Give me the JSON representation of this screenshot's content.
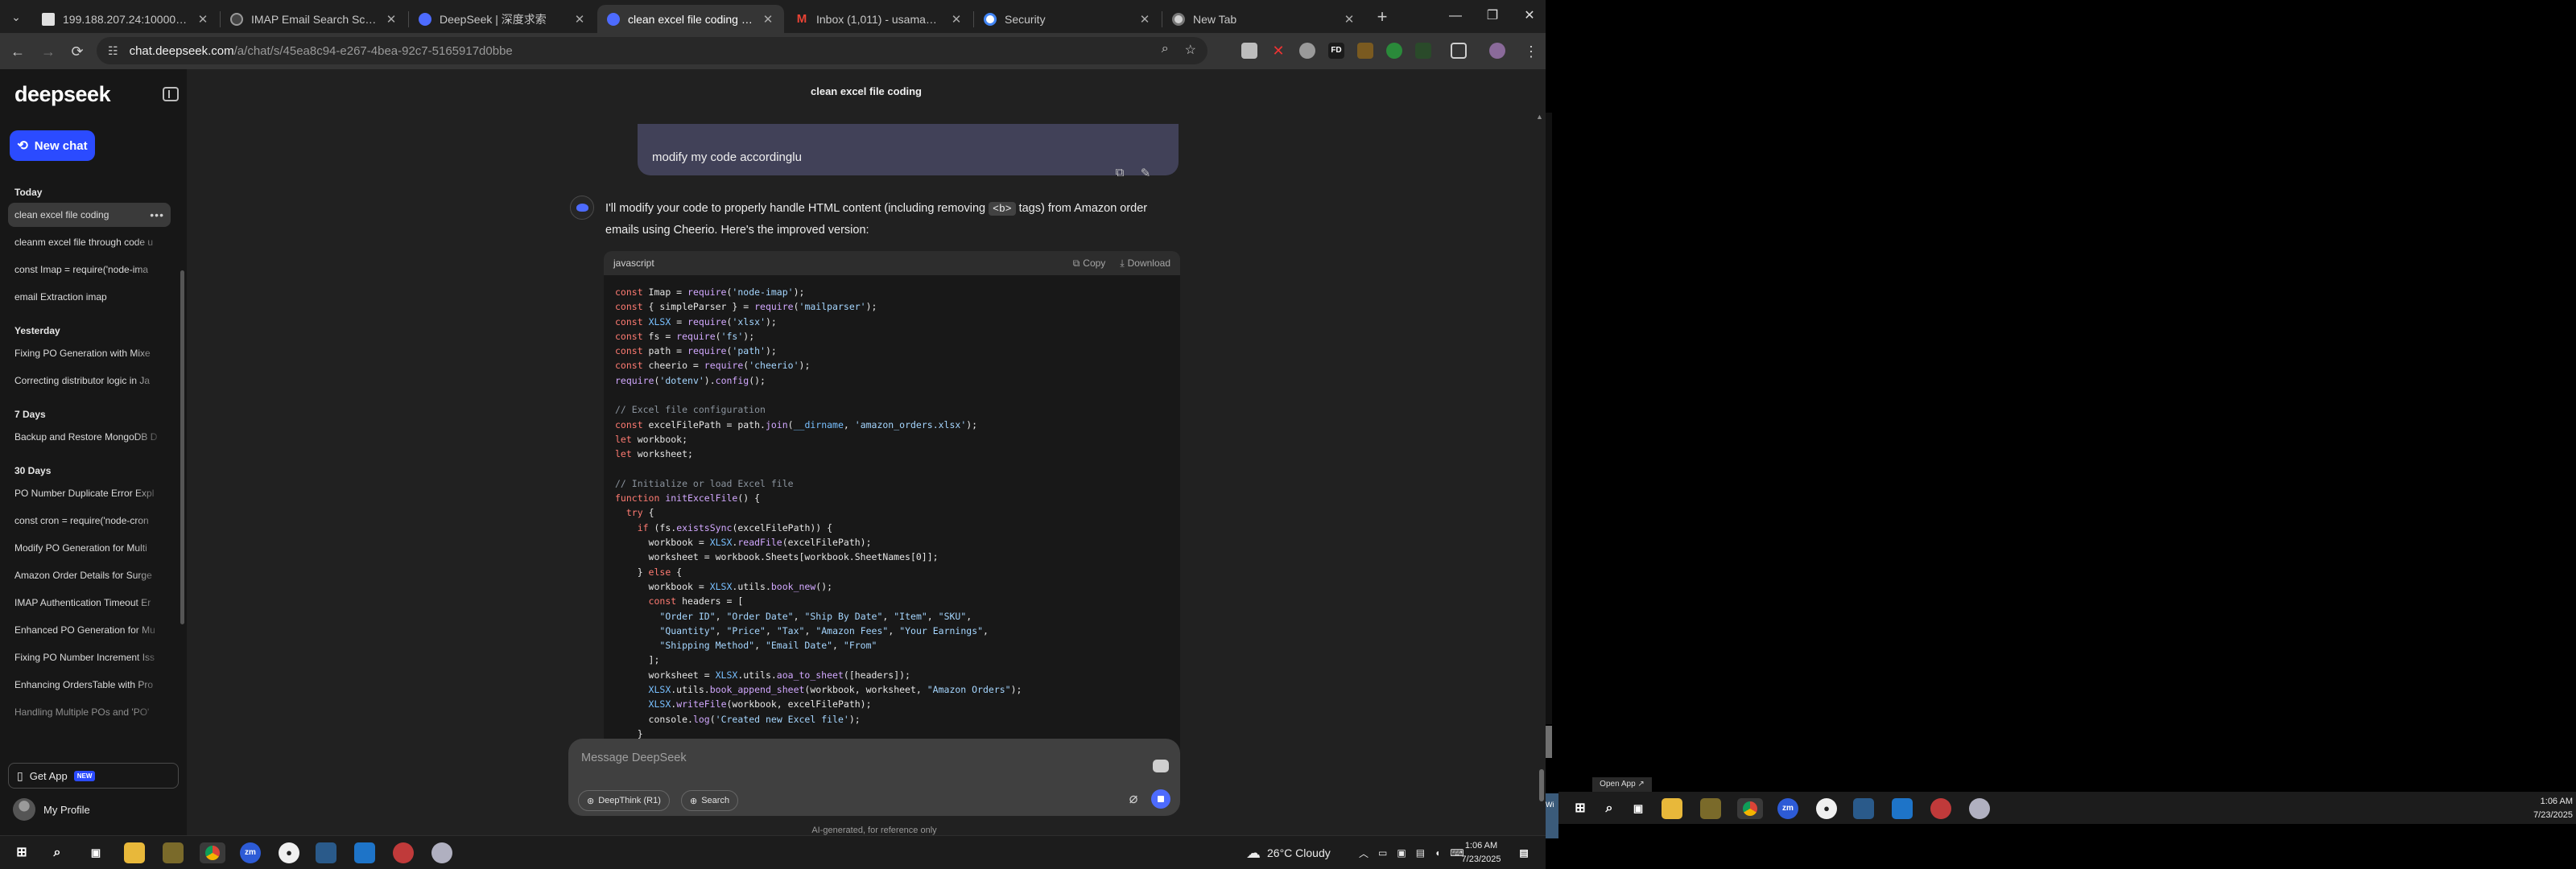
{
  "browser": {
    "tabs": [
      {
        "title": "199.188.207.24:10000/dashbo",
        "favicon": "warning-icon",
        "favicon_color": "#e0e0e0"
      },
      {
        "title": "IMAP Email Search Script",
        "favicon": "openai-icon",
        "favicon_color": "#444444"
      },
      {
        "title": "DeepSeek | 深度求索",
        "favicon": "deepseek-icon",
        "favicon_color": "#4d6bfe"
      },
      {
        "title": "clean excel file coding - Deeps",
        "favicon": "deepseek-icon",
        "favicon_color": "#4d6bfe"
      },
      {
        "title": "Inbox (1,011) - usamabin2580",
        "favicon": "gmail-icon",
        "favicon_color": "#ea4335"
      },
      {
        "title": "Security",
        "favicon": "google-icon",
        "favicon_color": "#ffffff"
      },
      {
        "title": "New Tab",
        "favicon": "chrome-icon",
        "favicon_color": "#d0d0d0"
      }
    ],
    "active_tab": 3,
    "url_host": "chat.deepseek.com",
    "url_path": "/a/chat/s/45ea8c94-e267-4bea-92c7-5165917d0bbe"
  },
  "sidebar": {
    "logo": "deepseek",
    "new_chat": "New chat",
    "groups": [
      {
        "label": "Today",
        "items": [
          "clean excel file coding",
          "cleanm excel file through code u",
          "const Imap = require('node-ima",
          "email Extraction imap"
        ]
      },
      {
        "label": "Yesterday",
        "items": [
          "Fixing PO Generation with Mixe",
          "Correcting distributor logic in Ja"
        ]
      },
      {
        "label": "7 Days",
        "items": [
          "Backup and Restore MongoDB D"
        ]
      },
      {
        "label": "30 Days",
        "items": [
          "PO Number Duplicate Error Expl",
          "const cron = require('node-cron",
          "Modify PO Generation for Multi",
          "Amazon Order Details for Surge",
          "IMAP Authentication Timeout Er",
          "Enhanced PO Generation for Mu",
          "Fixing PO Number Increment Iss",
          "Enhancing OrdersTable with Pro",
          "Handling Multiple POs and 'PO'"
        ]
      }
    ],
    "get_app": "Get App",
    "get_app_badge": "NEW",
    "profile": "My Profile"
  },
  "chat": {
    "title": "clean excel file coding",
    "user_message": "modify my code accordinglu",
    "answer_before": "I'll modify your code to properly handle HTML content (including removing ",
    "answer_code": "<b>",
    "answer_after": " tags) from Amazon order emails using Cheerio. Here's the improved version:",
    "code_lang": "javascript",
    "copy_label": "Copy",
    "download_label": "Download",
    "code_lines": [
      "const Imap = require('node-imap');",
      "const { simpleParser } = require('mailparser');",
      "const XLSX = require('xlsx');",
      "const fs = require('fs');",
      "const path = require('path');",
      "const cheerio = require('cheerio');",
      "require('dotenv').config();",
      "",
      "// Excel file configuration",
      "const excelFilePath = path.join(__dirname, 'amazon_orders.xlsx');",
      "let workbook;",
      "let worksheet;",
      "",
      "// Initialize or load Excel file",
      "function initExcelFile() {",
      "  try {",
      "    if (fs.existsSync(excelFilePath)) {",
      "      workbook = XLSX.readFile(excelFilePath);",
      "      worksheet = workbook.Sheets[workbook.SheetNames[0]];",
      "    } else {",
      "      workbook = XLSX.utils.book_new();",
      "      const headers = [",
      "        \"Order ID\", \"Order Date\", \"Ship By Date\", \"Item\", \"SKU\",",
      "        \"Quantity\", \"Price\", \"Tax\", \"Amazon Fees\", \"Your Earnings\",",
      "        \"Shipping Method\", \"Email Date\", \"From\"",
      "      ];",
      "      worksheet = XLSX.utils.aoa_to_sheet([headers]);",
      "      XLSX.utils.book_append_sheet(workbook, worksheet, \"Amazon Orders\");",
      "      XLSX.writeFile(workbook, excelFilePath);",
      "      console.log('Created new Excel file');",
      "    }"
    ],
    "composer_placeholder": "Message DeepSeek",
    "deepthink_label": "DeepThink (R1)",
    "search_label": "Search",
    "disclaimer": "AI-generated, for reference only"
  },
  "taskbar": {
    "weather": "26°C  Cloudy",
    "time": "1:06 AM",
    "date": "7/23/2025"
  },
  "monitor2": {
    "open_app": "Open App ↗",
    "edge_label": "Wi",
    "time": "1:06 AM",
    "date": "7/23/2025"
  }
}
